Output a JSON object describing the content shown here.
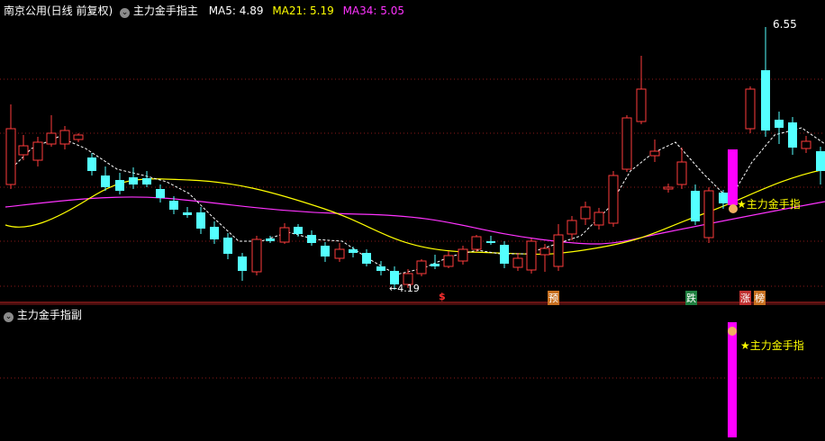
{
  "header": {
    "stock_label": "南京公用(日线 前复权)",
    "indicator_name": "主力金手指主",
    "ma5_label": "MA5:",
    "ma5_value": "4.89",
    "ma21_label": "MA21:",
    "ma21_value": "5.19",
    "ma34_label": "MA34:",
    "ma34_value": "5.05"
  },
  "sub_panel": {
    "title": "主力金手指副",
    "signal_label": "★主力金手指"
  },
  "main_panel": {
    "signal_label": "★主力金手指",
    "high_label": "6.55",
    "low_label": "←4.19",
    "markers": [
      {
        "text": "$",
        "color": "#ff3030"
      },
      {
        "text": "预",
        "color": "#ffffff",
        "bg": "#c87020"
      },
      {
        "text": "跌",
        "color": "#ffffff",
        "bg": "#208040"
      },
      {
        "text": "涨",
        "color": "#ffffff",
        "bg": "#c03030"
      },
      {
        "text": "榜",
        "color": "#ffffff",
        "bg": "#c87020"
      }
    ]
  },
  "colors": {
    "background": "#000000",
    "up": "#ff3c3c",
    "down": "#54ffff",
    "ma5": "#ffffff",
    "ma21": "#ffff00",
    "ma34": "#ff33ff",
    "signal": "#ff00ff",
    "grid": "#8b1a1a"
  },
  "chart_data": {
    "type": "candlestick",
    "low_price": 4.19,
    "high_price": 6.55,
    "ma5_last": 4.89,
    "ma21_last": 5.19,
    "ma34_last": 5.05,
    "signal_bar_index": 48
  }
}
